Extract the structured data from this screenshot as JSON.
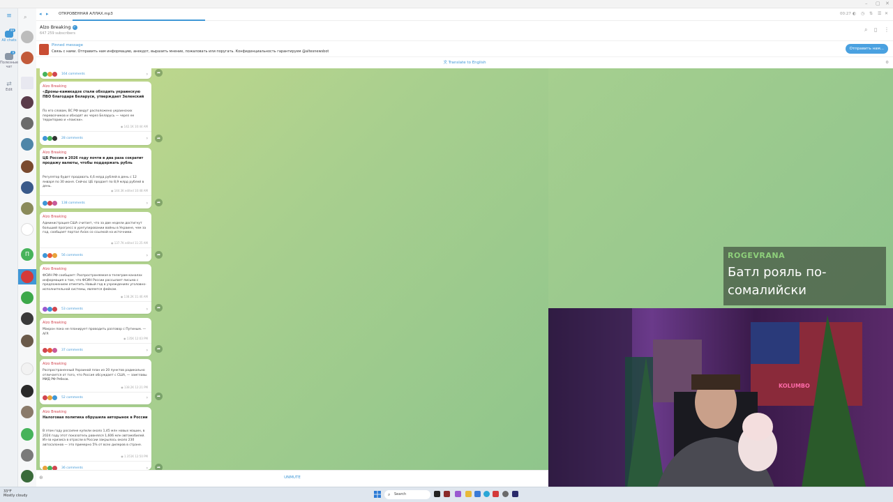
{
  "window": {
    "controls": [
      "–",
      "▢",
      "✕"
    ]
  },
  "rail": {
    "items": [
      {
        "label": "All chats",
        "badge": "99"
      },
      {
        "label": "Полезные чат",
        "badge": "9"
      },
      {
        "label": "Edit",
        "badge": ""
      }
    ]
  },
  "audio": {
    "title": "ОТКРОВЕННАЯ АЛЛАХ.mp3",
    "time": "00:27",
    "progress": 0.155
  },
  "channel": {
    "name": "Alzo Breaking",
    "subscribers": "647 259 subscribers"
  },
  "pinned": {
    "label": "Pinned message",
    "text": "Связь с нами. Отправить нам информацию, анекдот, выразить мнение, пожаловать или поругать. Конфиденциальность гарантируем @altesnewsbot",
    "button": "Отправить нам..."
  },
  "translate": {
    "label": "Translate to English"
  },
  "messages": [
    {
      "author": "",
      "title": "",
      "body": "",
      "meta": "",
      "comments": "164 comments"
    },
    {
      "author": "Alzo Breaking",
      "title": "«Дроны-камикадзе стали обходить украинскую ПВО благодаря Беларуси, утверждает Зеленский",
      "body": "По его словам, ВС РФ ведут расположено украинских перевозчиков и обходят их через Беларусь — через ее территорию и «поиски».",
      "meta": "142.1K  10:44 AM",
      "comments": "28 comments"
    },
    {
      "author": "Alzo Breaking",
      "title": "ЦБ России в 2026 году почти в два раза сократит продажу валюты, чтобы поддержать рубль",
      "body": "Регулятор будет продавать 4,6 млрд рублей в день с 12 января по 30 июня. Сейчас ЦБ продает по 8,9 млрд рублей в день.",
      "meta": "144.3K  edited 10:48 AM",
      "comments": "138 comments"
    },
    {
      "author": "Alzo Breaking",
      "title": "",
      "body": "Администрация США считает, что за две недели достигнут больший прогресс в урегулировании войны в Украине, чем за год, сообщает портал Axios со ссылкой на источники.",
      "meta": "137.7K  edited 11:25 AM",
      "comments": "56 comments"
    },
    {
      "author": "Alzo Breaking",
      "title": "",
      "body": "ФСИН РФ сообщает: Распространяемая в телеграм-каналах информация о том, что ФСИН России рассылает письма с предложением отметить Новый год в учреждениях уголовно-исполнительной системы, является фейком.",
      "meta": "138.2K  11:46 AM",
      "comments": "53 comments"
    },
    {
      "author": "Alzo Breaking",
      "title": "",
      "body": "Макрон пока не планирует проводить разговор с Путиным. — AFP.",
      "meta": "135K  12:03 PM",
      "comments": "37 comments"
    },
    {
      "author": "Alzo Breaking",
      "title": "",
      "body": "Распространенный Украиной план из 20 пунктов радикально отличается от того, что Россия обсуждает с США, — замглавы МИД РФ Рябков.",
      "meta": "138.2K  12:21 PM",
      "comments": "52 comments"
    },
    {
      "author": "Alzo Breaking",
      "title": "Налоговая политика обрушила авторынок в России",
      "body": "В этом году россияне купили около 1,45 млн новых машин, в 2024 году этот показатель равнялся 1,606 млн автомобилей. Из-за кризиса в отрасли в России закрылось около 230 автосалонов — это примерно 5% от всех дилеров в стране.",
      "meta": "1.351K  12:50 PM",
      "comments": "36 comments"
    }
  ],
  "footer": {
    "unmute": "UNMUTE"
  },
  "overlay": {
    "name": "ROGEVRANA",
    "text": "Батл рояль по-сомалийски"
  },
  "taskbar": {
    "temp": "33°F",
    "weather": "Mostly cloudy",
    "search": "Search"
  },
  "colors": {
    "accent": "#3f97d6",
    "author": "#d1454f",
    "overlay_name": "#8ed07b"
  }
}
